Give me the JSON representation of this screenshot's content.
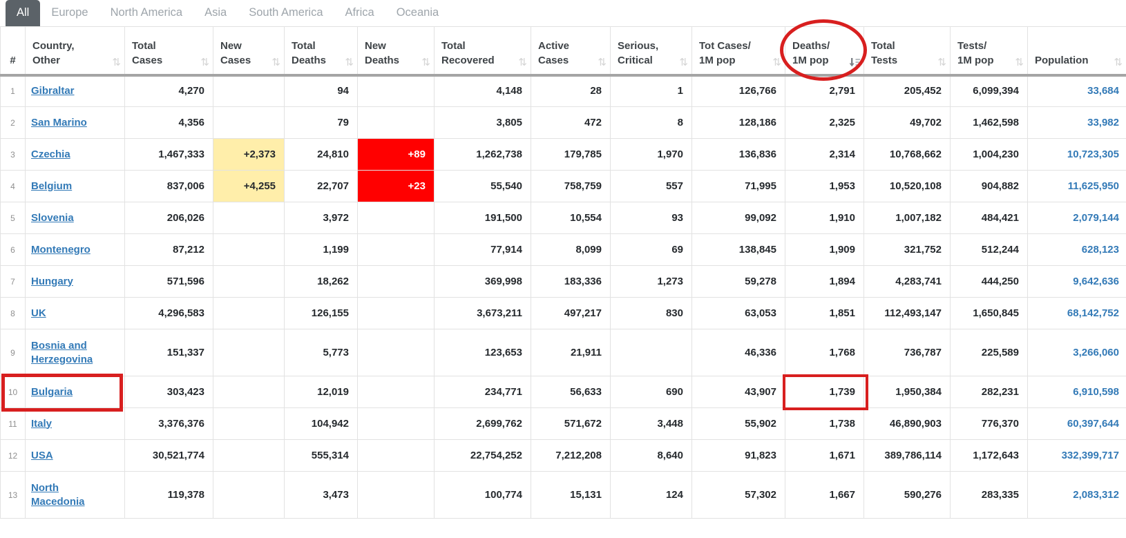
{
  "tabs": [
    {
      "label": "All",
      "active": true
    },
    {
      "label": "Europe",
      "active": false
    },
    {
      "label": "North America",
      "active": false
    },
    {
      "label": "Asia",
      "active": false
    },
    {
      "label": "South America",
      "active": false
    },
    {
      "label": "Africa",
      "active": false
    },
    {
      "label": "Oceania",
      "active": false
    }
  ],
  "sort": {
    "column": "deaths_1m",
    "direction": "desc"
  },
  "icons": {
    "sort_inactive": "⇅",
    "sort_active_desc": "sort-amount-desc"
  },
  "colors": {
    "active_tab_bg": "#5b6268",
    "inactive_tab_text": "#9ea5ab",
    "link_blue": "#337ab7",
    "cell_text": "#262a2e",
    "highlight_yellow": "#ffeeaa",
    "highlight_red": "#ff0000",
    "annotation_red": "#d81f1f"
  },
  "table": {
    "columns": [
      {
        "id": "rank",
        "line1": "#",
        "line2": "",
        "sortable": false
      },
      {
        "id": "country",
        "line1": "Country,",
        "line2": "Other",
        "sortable": true
      },
      {
        "id": "total_cases",
        "line1": "Total",
        "line2": "Cases",
        "sortable": true
      },
      {
        "id": "new_cases",
        "line1": "New",
        "line2": "Cases",
        "sortable": true
      },
      {
        "id": "total_deaths",
        "line1": "Total",
        "line2": "Deaths",
        "sortable": true
      },
      {
        "id": "new_deaths",
        "line1": "New",
        "line2": "Deaths",
        "sortable": true
      },
      {
        "id": "total_recovered",
        "line1": "Total",
        "line2": "Recovered",
        "sortable": true
      },
      {
        "id": "active_cases",
        "line1": "Active",
        "line2": "Cases",
        "sortable": true
      },
      {
        "id": "serious_critical",
        "line1": "Serious,",
        "line2": "Critical",
        "sortable": true
      },
      {
        "id": "tot_cases_1m",
        "line1": "Tot Cases/",
        "line2": "1M pop",
        "sortable": true
      },
      {
        "id": "deaths_1m",
        "line1": "Deaths/",
        "line2": "1M pop",
        "sortable": true,
        "sorted": "desc"
      },
      {
        "id": "total_tests",
        "line1": "Total",
        "line2": "Tests",
        "sortable": true
      },
      {
        "id": "tests_1m",
        "line1": "Tests/",
        "line2": "1M pop",
        "sortable": true
      },
      {
        "id": "population",
        "line1": "Population",
        "line2": "",
        "sortable": true
      }
    ],
    "rows": [
      {
        "rank": "1",
        "country": "Gibraltar",
        "total_cases": "4,270",
        "new_cases": "",
        "total_deaths": "94",
        "new_deaths": "",
        "total_recovered": "4,148",
        "active_cases": "28",
        "serious_critical": "1",
        "tot_cases_1m": "126,766",
        "deaths_1m": "2,791",
        "total_tests": "205,452",
        "tests_1m": "6,099,394",
        "population": "33,684"
      },
      {
        "rank": "2",
        "country": "San Marino",
        "total_cases": "4,356",
        "new_cases": "",
        "total_deaths": "79",
        "new_deaths": "",
        "total_recovered": "3,805",
        "active_cases": "472",
        "serious_critical": "8",
        "tot_cases_1m": "128,186",
        "deaths_1m": "2,325",
        "total_tests": "49,702",
        "tests_1m": "1,462,598",
        "population": "33,982"
      },
      {
        "rank": "3",
        "country": "Czechia",
        "total_cases": "1,467,333",
        "new_cases": "+2,373",
        "total_deaths": "24,810",
        "new_deaths": "+89",
        "total_recovered": "1,262,738",
        "active_cases": "179,785",
        "serious_critical": "1,970",
        "tot_cases_1m": "136,836",
        "deaths_1m": "2,314",
        "total_tests": "10,768,662",
        "tests_1m": "1,004,230",
        "population": "10,723,305"
      },
      {
        "rank": "4",
        "country": "Belgium",
        "total_cases": "837,006",
        "new_cases": "+4,255",
        "total_deaths": "22,707",
        "new_deaths": "+23",
        "total_recovered": "55,540",
        "active_cases": "758,759",
        "serious_critical": "557",
        "tot_cases_1m": "71,995",
        "deaths_1m": "1,953",
        "total_tests": "10,520,108",
        "tests_1m": "904,882",
        "population": "11,625,950"
      },
      {
        "rank": "5",
        "country": "Slovenia",
        "total_cases": "206,026",
        "new_cases": "",
        "total_deaths": "3,972",
        "new_deaths": "",
        "total_recovered": "191,500",
        "active_cases": "10,554",
        "serious_critical": "93",
        "tot_cases_1m": "99,092",
        "deaths_1m": "1,910",
        "total_tests": "1,007,182",
        "tests_1m": "484,421",
        "population": "2,079,144"
      },
      {
        "rank": "6",
        "country": "Montenegro",
        "total_cases": "87,212",
        "new_cases": "",
        "total_deaths": "1,199",
        "new_deaths": "",
        "total_recovered": "77,914",
        "active_cases": "8,099",
        "serious_critical": "69",
        "tot_cases_1m": "138,845",
        "deaths_1m": "1,909",
        "total_tests": "321,752",
        "tests_1m": "512,244",
        "population": "628,123"
      },
      {
        "rank": "7",
        "country": "Hungary",
        "total_cases": "571,596",
        "new_cases": "",
        "total_deaths": "18,262",
        "new_deaths": "",
        "total_recovered": "369,998",
        "active_cases": "183,336",
        "serious_critical": "1,273",
        "tot_cases_1m": "59,278",
        "deaths_1m": "1,894",
        "total_tests": "4,283,741",
        "tests_1m": "444,250",
        "population": "9,642,636"
      },
      {
        "rank": "8",
        "country": "UK",
        "total_cases": "4,296,583",
        "new_cases": "",
        "total_deaths": "126,155",
        "new_deaths": "",
        "total_recovered": "3,673,211",
        "active_cases": "497,217",
        "serious_critical": "830",
        "tot_cases_1m": "63,053",
        "deaths_1m": "1,851",
        "total_tests": "112,493,147",
        "tests_1m": "1,650,845",
        "population": "68,142,752"
      },
      {
        "rank": "9",
        "country": "Bosnia and Herzegovina",
        "total_cases": "151,337",
        "new_cases": "",
        "total_deaths": "5,773",
        "new_deaths": "",
        "total_recovered": "123,653",
        "active_cases": "21,911",
        "serious_critical": "",
        "tot_cases_1m": "46,336",
        "deaths_1m": "1,768",
        "total_tests": "736,787",
        "tests_1m": "225,589",
        "population": "3,266,060"
      },
      {
        "rank": "10",
        "country": "Bulgaria",
        "total_cases": "303,423",
        "new_cases": "",
        "total_deaths": "12,019",
        "new_deaths": "",
        "total_recovered": "234,771",
        "active_cases": "56,633",
        "serious_critical": "690",
        "tot_cases_1m": "43,907",
        "deaths_1m": "1,739",
        "total_tests": "1,950,384",
        "tests_1m": "282,231",
        "population": "6,910,598"
      },
      {
        "rank": "11",
        "country": "Italy",
        "total_cases": "3,376,376",
        "new_cases": "",
        "total_deaths": "104,942",
        "new_deaths": "",
        "total_recovered": "2,699,762",
        "active_cases": "571,672",
        "serious_critical": "3,448",
        "tot_cases_1m": "55,902",
        "deaths_1m": "1,738",
        "total_tests": "46,890,903",
        "tests_1m": "776,370",
        "population": "60,397,644"
      },
      {
        "rank": "12",
        "country": "USA",
        "total_cases": "30,521,774",
        "new_cases": "",
        "total_deaths": "555,314",
        "new_deaths": "",
        "total_recovered": "22,754,252",
        "active_cases": "7,212,208",
        "serious_critical": "8,640",
        "tot_cases_1m": "91,823",
        "deaths_1m": "1,671",
        "total_tests": "389,786,114",
        "tests_1m": "1,172,643",
        "population": "332,399,717"
      },
      {
        "rank": "13",
        "country": "North Macedonia",
        "total_cases": "119,378",
        "new_cases": "",
        "total_deaths": "3,473",
        "new_deaths": "",
        "total_recovered": "100,774",
        "active_cases": "15,131",
        "serious_critical": "124",
        "tot_cases_1m": "57,302",
        "deaths_1m": "1,667",
        "total_tests": "590,276",
        "tests_1m": "283,335",
        "population": "2,083,312"
      }
    ]
  }
}
